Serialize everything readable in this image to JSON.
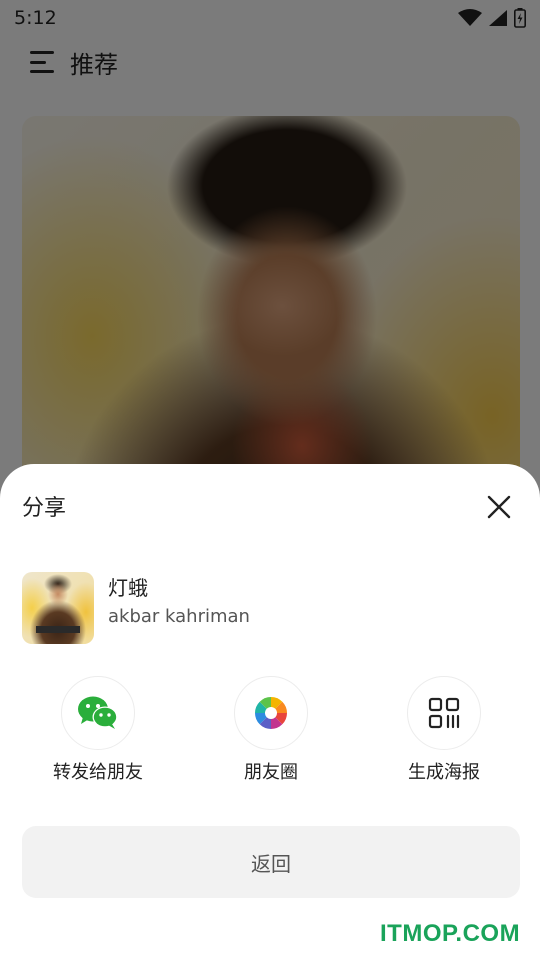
{
  "status_bar": {
    "time": "5:12"
  },
  "header": {
    "title": "推荐"
  },
  "share_sheet": {
    "title": "分享",
    "song": {
      "title": "灯蛾",
      "artist": "akbar kahriman"
    },
    "options": [
      {
        "label": "转发给朋友",
        "icon": "wechat-icon",
        "color": "#2aae3b"
      },
      {
        "label": "朋友圈",
        "icon": "moments-icon"
      },
      {
        "label": "生成海报",
        "icon": "poster-qr-icon"
      }
    ],
    "back_label": "返回"
  },
  "watermark": "ITMOP.COM",
  "colors": {
    "accent_green": "#2aae3b",
    "watermark_green": "#1aa35a",
    "sheet_bg": "#ffffff",
    "button_bg": "#f2f2f2"
  }
}
